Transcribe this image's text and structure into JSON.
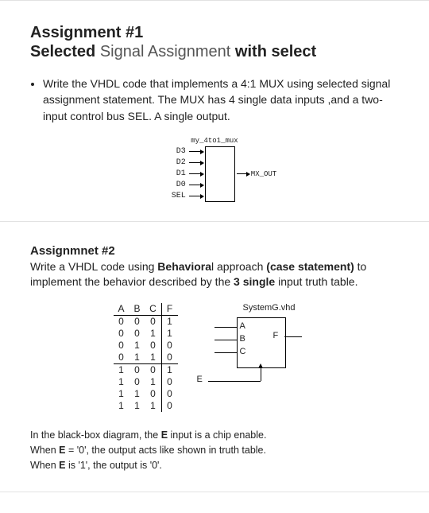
{
  "a1": {
    "title1": "Assignment #1",
    "title2_b1": "Selected",
    "title2_r": " Signal Assignment ",
    "title2_b2": "with select",
    "bullet": "Write the VHDL code that implements a 4:1 MUX using selected signal assignment statement. The MUX has 4 single data inputs ,and a two-input control bus SEL. A single output.",
    "mux": {
      "caption": "my_4to1_mux",
      "inputs": [
        "D3",
        "D2",
        "D1",
        "D0",
        "SEL"
      ],
      "output": "MX_OUT"
    }
  },
  "a2": {
    "title": "Assignmnet #2",
    "desc_p1": "Write a VHDL code using ",
    "desc_b1": "Behaviora",
    "desc_p1b": "l approach ",
    "desc_b2": "(case statement)",
    "desc_p2": " to implement the behavior described by the ",
    "desc_b3": "3 single",
    "desc_p3": " input truth table.",
    "truth_table": {
      "headers": [
        "A",
        "B",
        "C",
        "F"
      ],
      "rows": [
        [
          "0",
          "0",
          "0",
          "1"
        ],
        [
          "0",
          "0",
          "1",
          "1"
        ],
        [
          "0",
          "1",
          "0",
          "0"
        ],
        [
          "0",
          "1",
          "1",
          "0"
        ],
        [
          "1",
          "0",
          "0",
          "1"
        ],
        [
          "1",
          "0",
          "1",
          "0"
        ],
        [
          "1",
          "1",
          "0",
          "0"
        ],
        [
          "1",
          "1",
          "1",
          "0"
        ]
      ]
    },
    "block": {
      "caption": "SystemG.vhd",
      "in": [
        "A",
        "B",
        "C"
      ],
      "out": "F",
      "enable": "E"
    },
    "note1_a": "In the black-box diagram, the ",
    "note1_b": "E",
    "note1_c": " input is a chip enable.",
    "note2_a": "When ",
    "note2_b": "E",
    "note2_c": " = '0', the output acts like shown in truth table.",
    "note3_a": "When ",
    "note3_b": "E",
    "note3_c": " is '1', the output is '0'."
  },
  "chart_data": [
    {
      "type": "table",
      "title": "3-input truth table (A B C → F)",
      "headers": [
        "A",
        "B",
        "C",
        "F"
      ],
      "rows": [
        [
          0,
          0,
          0,
          1
        ],
        [
          0,
          0,
          1,
          1
        ],
        [
          0,
          1,
          0,
          0
        ],
        [
          0,
          1,
          1,
          0
        ],
        [
          1,
          0,
          0,
          1
        ],
        [
          1,
          0,
          1,
          0
        ],
        [
          1,
          1,
          0,
          0
        ],
        [
          1,
          1,
          1,
          0
        ]
      ]
    }
  ]
}
